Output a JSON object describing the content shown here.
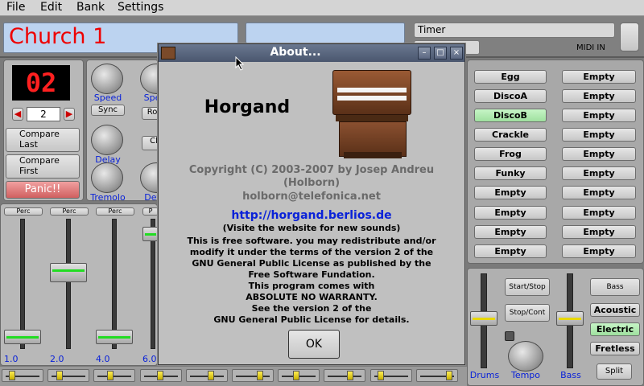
{
  "menu": [
    "File",
    "Edit",
    "Bank",
    "Settings"
  ],
  "menu_mnemonics": [
    "F",
    "E",
    "B",
    "S"
  ],
  "patch": {
    "name": "Church 1",
    "number": "02",
    "spin_value": "2"
  },
  "timer_label": "Timer",
  "midi_label": "MIDI IN",
  "left": {
    "compare_last": "Compare\nLast",
    "compare_first": "Compare\nFirst",
    "panic": "Panic!!"
  },
  "knobs": {
    "speed": "Speed",
    "sync": "Sync",
    "delay": "Delay",
    "tremolo": "Tremolo",
    "speed2": "Spe",
    "rot": "Rot",
    "cl": "Cl",
    "det": "Det"
  },
  "drawbars": {
    "perc_labels": [
      "Perc",
      "Perc",
      "Perc",
      "P"
    ],
    "values": [
      "1.0",
      "2.0",
      "4.0",
      "6.0"
    ]
  },
  "presets": {
    "col1": [
      "Egg",
      "DiscoA",
      "DiscoB",
      "Crackle",
      "Frog",
      "Funky",
      "Empty",
      "Empty",
      "Empty",
      "Empty"
    ],
    "col2": [
      "Empty",
      "Empty",
      "Empty",
      "Empty",
      "Empty",
      "Empty",
      "Empty",
      "Empty",
      "Empty",
      "Empty"
    ],
    "active": "DiscoB"
  },
  "rhythm": {
    "start_stop": "Start/Stop",
    "stop_cont": "Stop/Cont",
    "drums": "Drums",
    "tempo": "Tempo",
    "bass": "Bass",
    "bass_btn": "Bass",
    "acoustic": "Acoustic",
    "electric": "Electric",
    "fretless": "Fretless",
    "split": "Split"
  },
  "dialog": {
    "title": "About...",
    "app_name": "Horgand",
    "copyright": "Copyright (C) 2003-2007 by Josep Andreu",
    "copyright2": "(Holborn)",
    "email": "holborn@telefonica.net",
    "url": "http://horgand.berlios.de",
    "url_note": "(Visite the website for new sounds)",
    "license_lines": [
      "This is free software. you may redistribute and/or",
      "modify it under the terms of the version 2 of the",
      "GNU General Public License as published by the",
      "Free Software Fundation.",
      "This program comes with",
      "ABSOLUTE NO WARRANTY.",
      "See the version 2 of the",
      "GNU General Public License for details."
    ],
    "ok": "OK"
  },
  "colors": {
    "accent_blue": "#0a22d8",
    "red": "#ee0000",
    "green_active": "#9fe09f"
  }
}
